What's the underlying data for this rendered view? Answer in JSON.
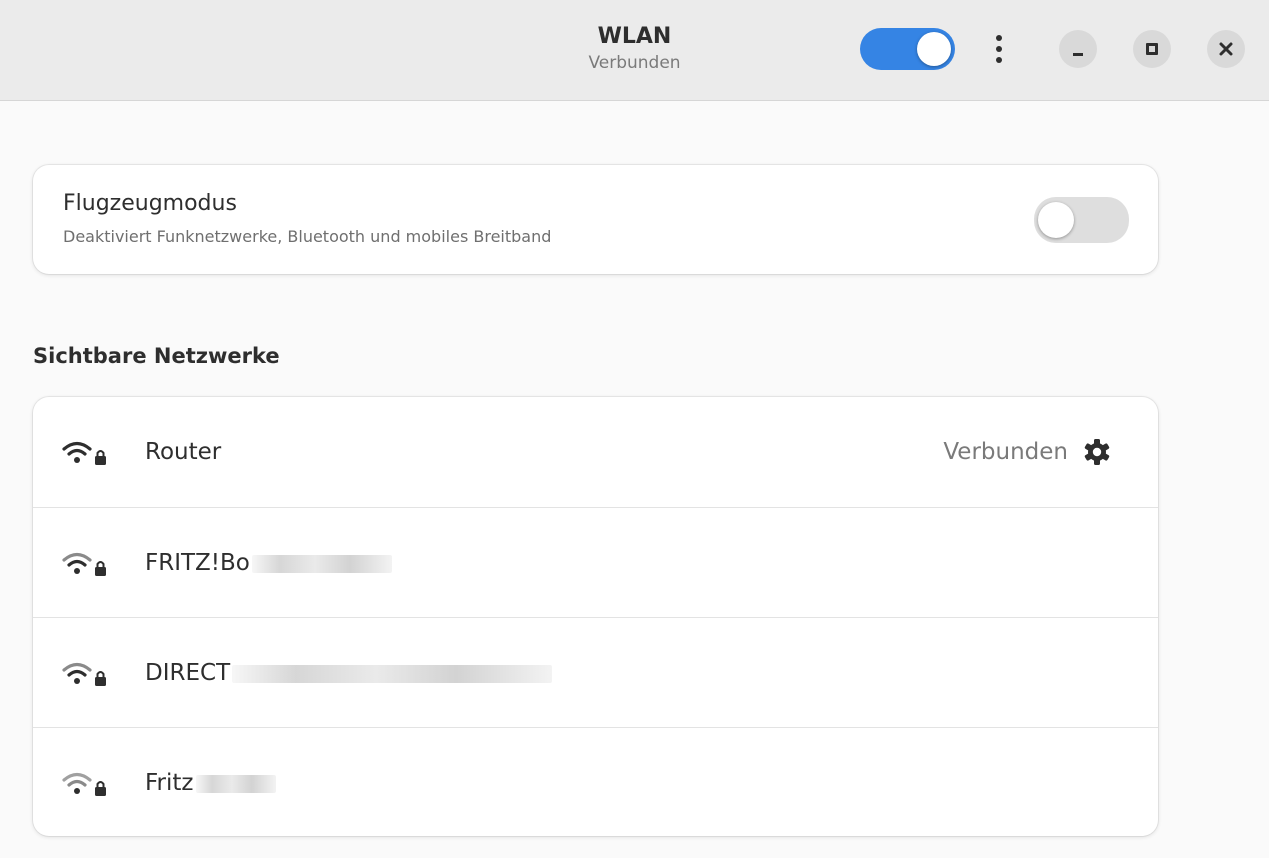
{
  "header": {
    "title": "WLAN",
    "subtitle": "Verbunden",
    "wlan_enabled": true
  },
  "airplane_mode": {
    "title": "Flugzeugmodus",
    "description": "Deaktiviert Funknetzwerke, Bluetooth und mobiles Breitband",
    "enabled": false
  },
  "visible_networks": {
    "heading": "Sichtbare Netzwerke",
    "items": [
      {
        "name": "Router",
        "status": "Verbunden",
        "secured": true,
        "signal": "full"
      },
      {
        "name": "FRITZ!Bo",
        "status": "",
        "secured": true,
        "signal": "good"
      },
      {
        "name": "DIRECT",
        "status": "",
        "secured": true,
        "signal": "good"
      },
      {
        "name": "Fritz",
        "status": "",
        "secured": true,
        "signal": "weak"
      }
    ]
  },
  "colors": {
    "accent": "#3584e4",
    "header_bg": "#ebebeb",
    "page_bg": "#fafafa"
  },
  "icons": {
    "menu": "vertical-ellipsis-icon",
    "minimize": "minimize-icon",
    "maximize": "maximize-icon",
    "close": "close-icon",
    "wifi": "wifi-secured-icon",
    "settings": "gear-icon"
  }
}
